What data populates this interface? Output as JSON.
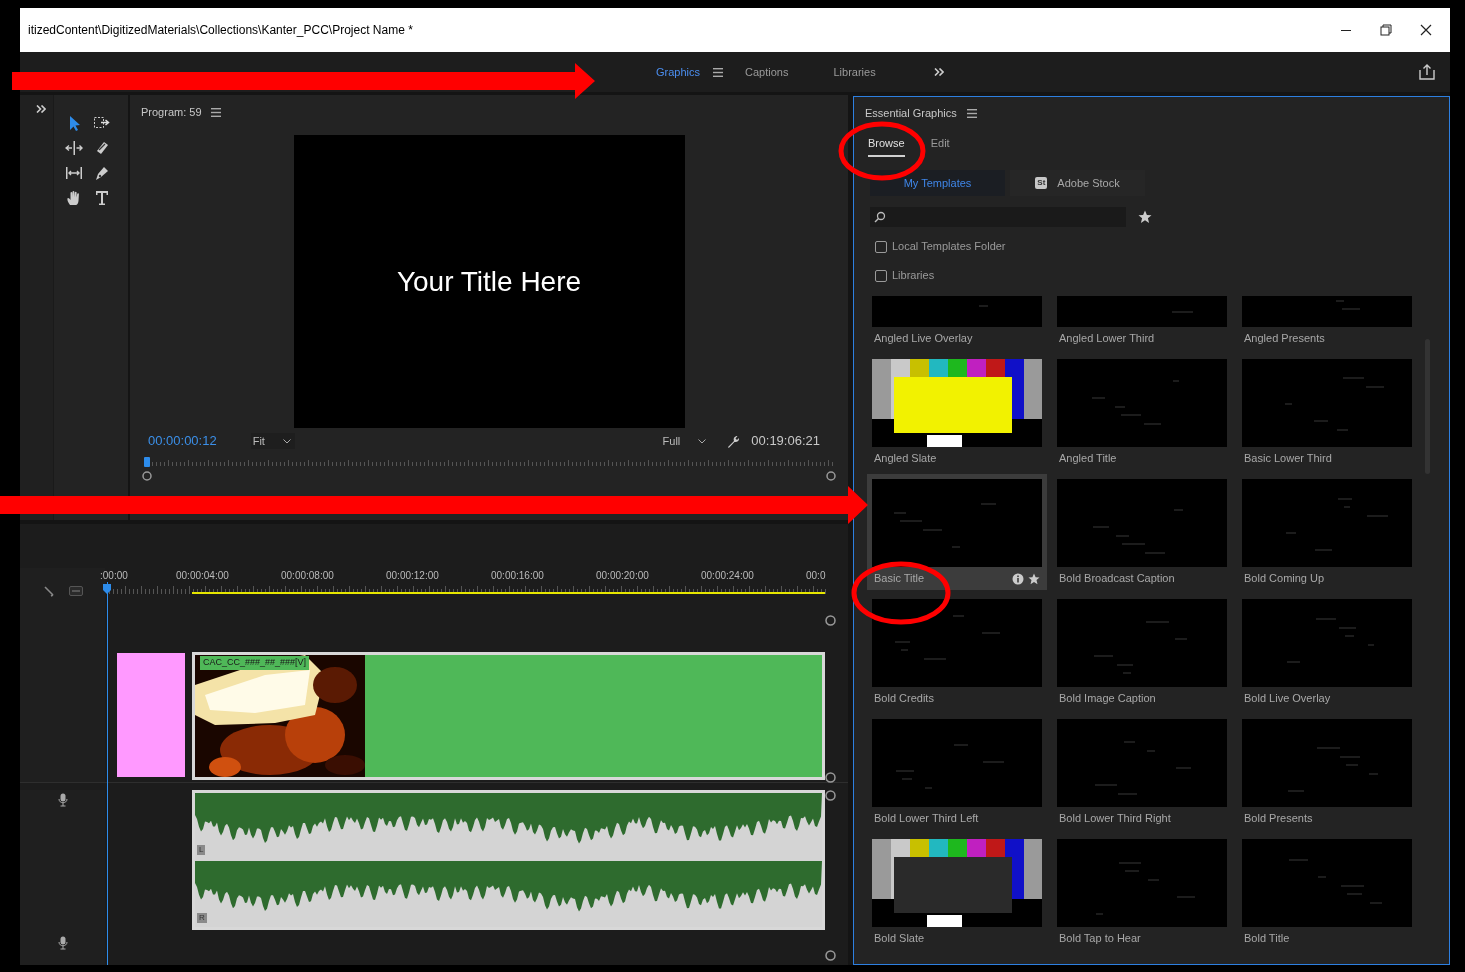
{
  "window": {
    "title": "itizedContent\\DigitizedMaterials\\Collections\\Kanter_PCC\\Project Name *"
  },
  "workspaces": [
    {
      "label": "Graphics",
      "selected": true
    },
    {
      "label": "Captions",
      "selected": false
    },
    {
      "label": "Libraries",
      "selected": false
    }
  ],
  "program_monitor": {
    "title": "Program: 59",
    "preview_text": "Your Title Here",
    "timecode": "00:00:00:12",
    "zoom": "Fit",
    "quality": "Full",
    "duration": "00:19:06:21"
  },
  "timeline": {
    "ruler": [
      ":00:00",
      "00:00:04:00",
      "00:00:08:00",
      "00:00:12:00",
      "00:00:16:00",
      "00:00:20:00",
      "00:00:24:00",
      "00:0"
    ],
    "video_clips": [
      {
        "kind": "color_matte",
        "color": "#ff99ff"
      },
      {
        "kind": "footage",
        "color": "#4fb858",
        "label": "CAC_CC_###_##_###[V]"
      }
    ],
    "audio_channels": [
      {
        "label": "L"
      },
      {
        "label": "R"
      }
    ]
  },
  "essential_graphics": {
    "title": "Essential Graphics",
    "tabs": [
      {
        "label": "Browse",
        "selected": true
      },
      {
        "label": "Edit",
        "selected": false
      }
    ],
    "sources": [
      {
        "label": "My Templates",
        "selected": true
      },
      {
        "label": "Adobe Stock",
        "badge": "St",
        "selected": false
      }
    ],
    "filters": [
      {
        "label": "Local Templates Folder",
        "checked": false
      },
      {
        "label": "Libraries",
        "checked": false
      }
    ],
    "templates": [
      {
        "name": "Angled Live Overlay",
        "selected": false
      },
      {
        "name": "Angled Lower Third",
        "selected": false
      },
      {
        "name": "Angled Presents",
        "selected": false
      },
      {
        "name": "Angled Slate",
        "selected": false
      },
      {
        "name": "Angled Title",
        "selected": false
      },
      {
        "name": "Basic Lower Third",
        "selected": false
      },
      {
        "name": "Basic Title",
        "selected": true
      },
      {
        "name": "Bold Broadcast Caption",
        "selected": false
      },
      {
        "name": "Bold Coming Up",
        "selected": false
      },
      {
        "name": "Bold Credits",
        "selected": false
      },
      {
        "name": "Bold Image Caption",
        "selected": false
      },
      {
        "name": "Bold Live Overlay",
        "selected": false
      },
      {
        "name": "Bold Lower Third Left",
        "selected": false
      },
      {
        "name": "Bold Lower Third Right",
        "selected": false
      },
      {
        "name": "Bold Presents",
        "selected": false
      },
      {
        "name": "Bold Slate",
        "selected": false
      },
      {
        "name": "Bold Tap to Hear",
        "selected": false
      },
      {
        "name": "Bold Title",
        "selected": false
      }
    ]
  }
}
